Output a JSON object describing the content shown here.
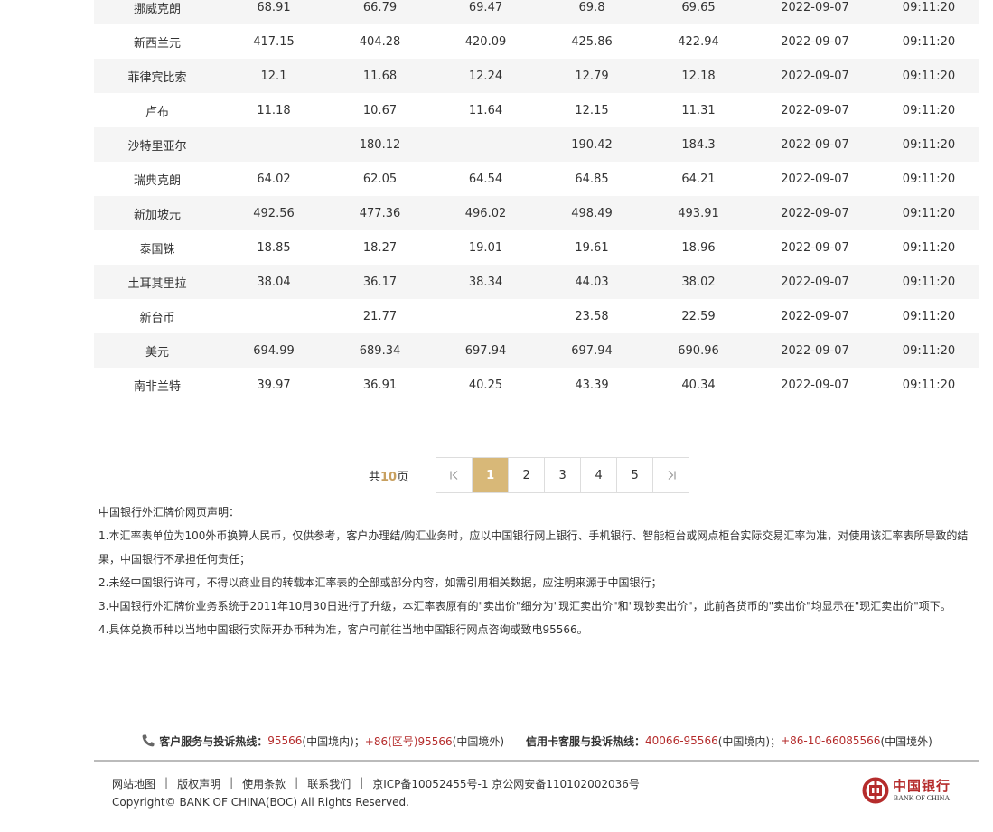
{
  "table": {
    "rows": [
      [
        "挪威克朗",
        "68.91",
        "66.79",
        "69.47",
        "69.8",
        "69.65",
        "2022-09-07",
        "09:11:20"
      ],
      [
        "新西兰元",
        "417.15",
        "404.28",
        "420.09",
        "425.86",
        "422.94",
        "2022-09-07",
        "09:11:20"
      ],
      [
        "菲律宾比索",
        "12.1",
        "11.68",
        "12.24",
        "12.79",
        "12.18",
        "2022-09-07",
        "09:11:20"
      ],
      [
        "卢布",
        "11.18",
        "10.67",
        "11.64",
        "12.15",
        "11.31",
        "2022-09-07",
        "09:11:20"
      ],
      [
        "沙特里亚尔",
        "",
        "180.12",
        "",
        "190.42",
        "184.3",
        "2022-09-07",
        "09:11:20"
      ],
      [
        "瑞典克朗",
        "64.02",
        "62.05",
        "64.54",
        "64.85",
        "64.21",
        "2022-09-07",
        "09:11:20"
      ],
      [
        "新加坡元",
        "492.56",
        "477.36",
        "496.02",
        "498.49",
        "493.91",
        "2022-09-07",
        "09:11:20"
      ],
      [
        "泰国铢",
        "18.85",
        "18.27",
        "19.01",
        "19.61",
        "18.96",
        "2022-09-07",
        "09:11:20"
      ],
      [
        "土耳其里拉",
        "38.04",
        "36.17",
        "38.34",
        "44.03",
        "38.02",
        "2022-09-07",
        "09:11:20"
      ],
      [
        "新台币",
        "",
        "21.77",
        "",
        "23.58",
        "22.59",
        "2022-09-07",
        "09:11:20"
      ],
      [
        "美元",
        "694.99",
        "689.34",
        "697.94",
        "697.94",
        "690.96",
        "2022-09-07",
        "09:11:20"
      ],
      [
        "南非兰特",
        "39.97",
        "36.91",
        "40.25",
        "43.39",
        "40.34",
        "2022-09-07",
        "09:11:20"
      ]
    ]
  },
  "pagination": {
    "total_prefix": "共",
    "total_pages": "10",
    "total_suffix": "页",
    "pages": [
      "1",
      "2",
      "3",
      "4",
      "5"
    ],
    "current": "1"
  },
  "disclaimer": {
    "title": "中国银行外汇牌价网页声明：",
    "items": [
      "1.本汇率表单位为100外币换算人民币，仅供参考，客户办理结/购汇业务时，应以中国银行网上银行、手机银行、智能柜台或网点柜台实际交易汇率为准，对使用该汇率表所导致的结果，中国银行不承担任何责任；",
      "2.未经中国银行许可，不得以商业目的转载本汇率表的全部或部分内容，如需引用相关数据，应注明来源于中国银行；",
      "3.中国银行外汇牌价业务系统于2011年10月30日进行了升级，本汇率表原有的\"卖出价\"细分为\"现汇卖出价\"和\"现钞卖出价\"，此前各货币的\"卖出价\"均显示在\"现汇卖出价\"项下。",
      "4.具体兑换币种以当地中国银行实际开办币种为准，客户可前往当地中国银行网点咨询或致电95566。"
    ]
  },
  "hotline": {
    "service_label": "客户服务与投诉热线：",
    "service_num1": "95566",
    "service_region1": "(中国境内)；",
    "service_num2": "+86(区号)95566",
    "service_region2": "(中国境外)",
    "card_label": "信用卡客服与投诉热线：",
    "card_num1": "40066-95566",
    "card_region1": "(中国境内)；",
    "card_num2": "+86-10-66085566",
    "card_region2": "(中国境外)"
  },
  "footer": {
    "links": [
      "网站地图",
      "版权声明",
      "使用条款",
      "联系我们"
    ],
    "icp": "京ICP备10052455号-1 京公网安备110102002036号",
    "separator": "|",
    "copyright": "Copyright© BANK OF CHINA(BOC) All Rights Reserved.",
    "logo_cn": "中国银行",
    "logo_en": "BANK OF CHINA"
  },
  "colors": {
    "accent_gold": "#d8b878",
    "brand_red": "#b52c2c",
    "row_stripe": "#f5f5f5"
  },
  "icons": {
    "first_page": "first-page-icon",
    "last_page": "last-page-icon",
    "phone": "phone-icon",
    "logo": "boc-logo-icon"
  }
}
